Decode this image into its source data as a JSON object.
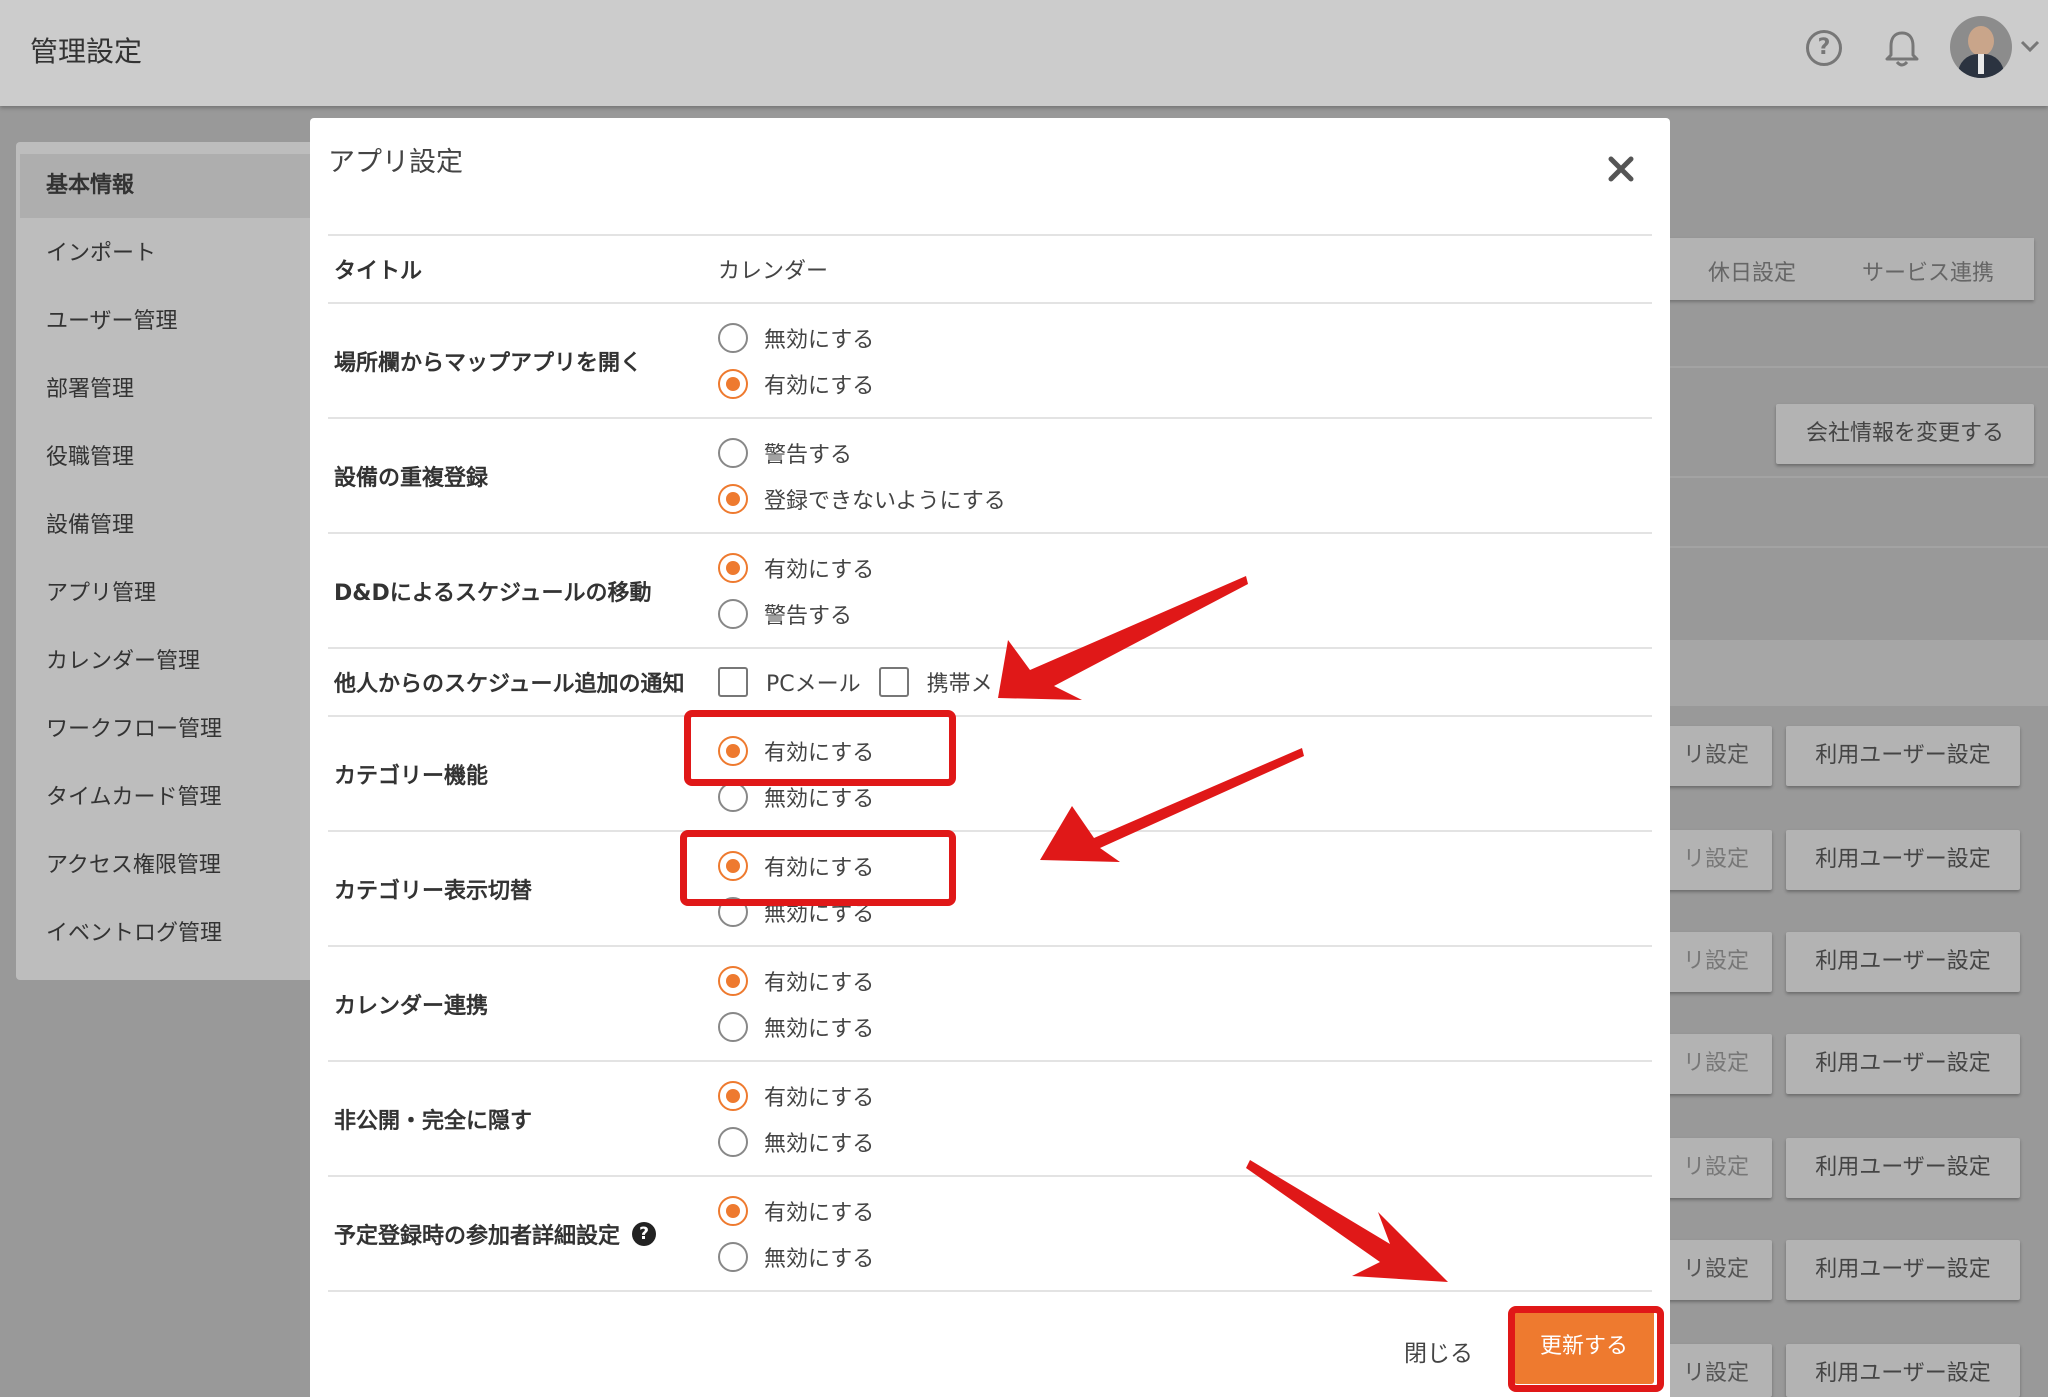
{
  "header": {
    "title": "管理設定"
  },
  "sidebar": {
    "items": [
      "基本情報",
      "インポート",
      "ユーザー管理",
      "部署管理",
      "役職管理",
      "設備管理",
      "アプリ管理",
      "カレンダー管理",
      "ワークフロー管理",
      "タイムカード管理",
      "アクセス権限管理",
      "イベントログ管理"
    ]
  },
  "background": {
    "tabs": [
      "休日設定",
      "サービス連携"
    ],
    "company_button": "会社情報を変更する",
    "app_setting_partial": "リ設定",
    "user_setting_button": "利用ユーザー設定"
  },
  "modal": {
    "title": "アプリ設定",
    "rows": {
      "title": {
        "label": "タイトル",
        "value": "カレンダー"
      },
      "map": {
        "label": "場所欄からマップアプリを開く",
        "options": [
          "無効にする",
          "有効にする"
        ]
      },
      "duplicate": {
        "label": "設備の重複登録",
        "options": [
          "警告する",
          "登録できないようにする"
        ]
      },
      "dnd": {
        "label": "D&Dによるスケジュールの移動",
        "options": [
          "有効にする",
          "警告する"
        ]
      },
      "notify": {
        "label": "他人からのスケジュール追加の通知",
        "options": [
          "PCメール",
          "携帯メ"
        ]
      },
      "category": {
        "label": "カテゴリー機能",
        "options": [
          "有効にする",
          "無効にする"
        ]
      },
      "category_switch": {
        "label": "カテゴリー表示切替",
        "options": [
          "有効にする",
          "無効にする"
        ]
      },
      "calendar_link": {
        "label": "カレンダー連携",
        "options": [
          "有効にする",
          "無効にする"
        ]
      },
      "private": {
        "label": "非公開・完全に隠す",
        "options": [
          "有効にする",
          "無効にする"
        ]
      },
      "participant": {
        "label": "予定登録時の参加者詳細設定",
        "options": [
          "有効にする",
          "無効にする"
        ]
      }
    },
    "close_label": "閉じる",
    "update_label": "更新する"
  },
  "colors": {
    "accent": "#ee7a2f",
    "annotation": "#e01818"
  }
}
